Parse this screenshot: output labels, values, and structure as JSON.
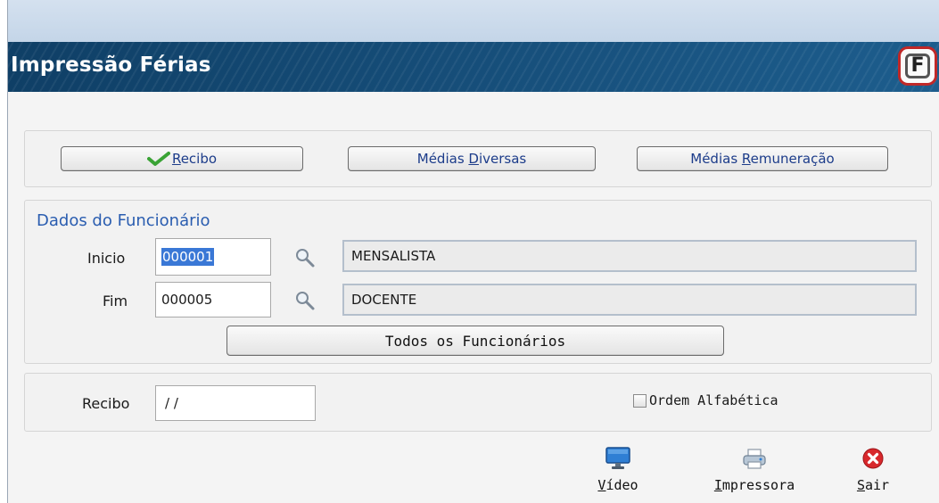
{
  "window": {
    "title": "Impressão Férias",
    "logo_letter": "F"
  },
  "tabs": {
    "recibo": {
      "u": "R",
      "rest": "ecibo"
    },
    "medias_diversas": {
      "pre": "Médias ",
      "u": "D",
      "rest": "iversas"
    },
    "medias_remuneracao": {
      "pre": "Médias ",
      "u": "R",
      "rest": "emuneração"
    }
  },
  "funcionario": {
    "section_title": "Dados do Funcionário",
    "inicio_label": "Inicio",
    "inicio_value": "000001",
    "inicio_desc": "MENSALISTA",
    "fim_label": "Fim",
    "fim_value": "000005",
    "fim_desc": "DOCENTE",
    "todos_button": "Todos os Funcionários"
  },
  "recibo": {
    "label": "Recibo",
    "value": "/ /",
    "ordem_label": "Ordem Alfabética",
    "ordem_checked": false
  },
  "toolbar": {
    "video": {
      "u": "V",
      "rest": "ídeo"
    },
    "impressora": {
      "u": "I",
      "rest": "mpressora"
    },
    "sair": {
      "u": "S",
      "rest": "air"
    }
  },
  "colors": {
    "title_bar": "#1a4f7a",
    "link_text": "#1c3c8a",
    "section_title": "#2a5db0",
    "selection": "#3a78d6"
  }
}
